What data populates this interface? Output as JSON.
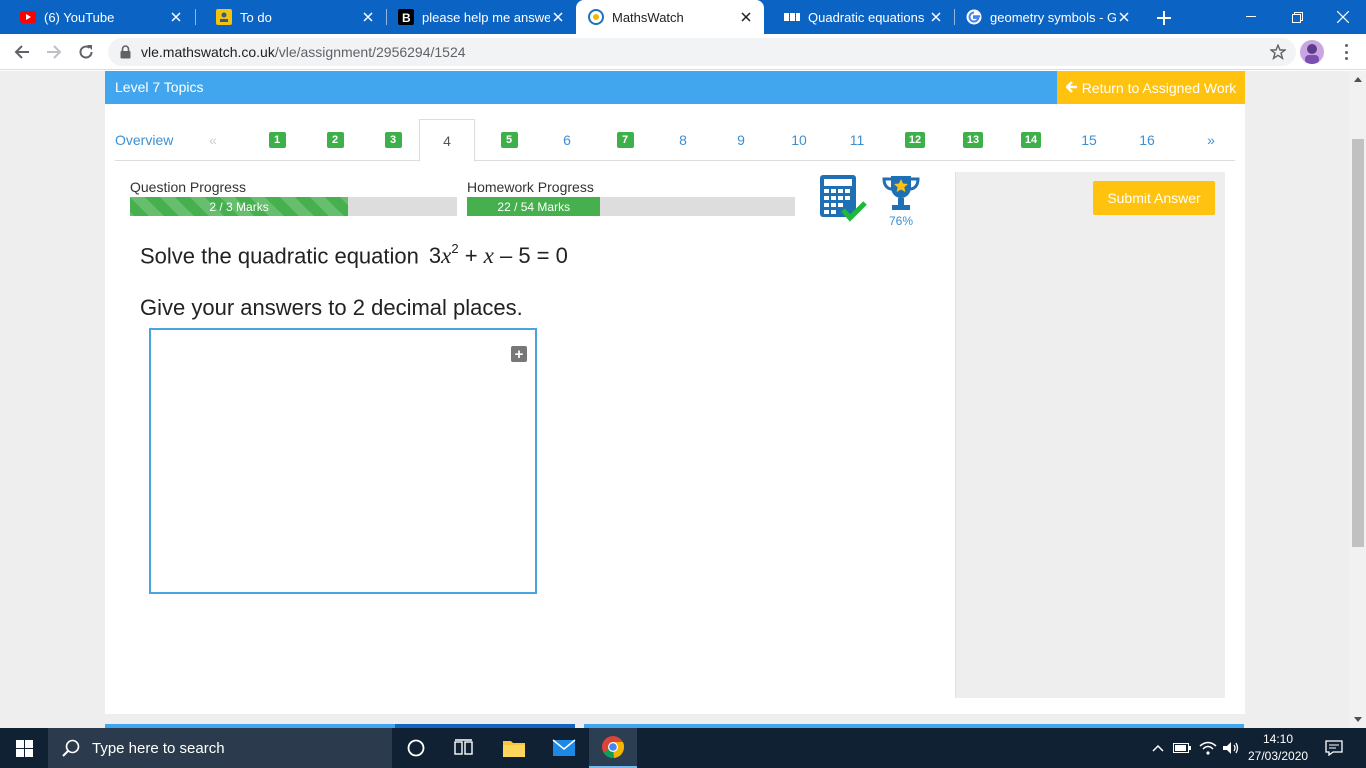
{
  "browser": {
    "tabs": [
      {
        "title": "(6) YouTube",
        "icon": "youtube-icon"
      },
      {
        "title": "To do",
        "icon": "todo-icon"
      },
      {
        "title": "please help me answer",
        "icon": "brainly-icon"
      },
      {
        "title": "MathsWatch",
        "icon": "mathswatch-icon",
        "active": true
      },
      {
        "title": "Quadratic equations - S",
        "icon": "bbc-icon"
      },
      {
        "title": "geometry symbols - Go",
        "icon": "google-icon"
      }
    ],
    "url_host": "vle.mathswatch.co.uk",
    "url_path": "/vle/assignment/2956294/1524"
  },
  "header": {
    "level_title": "Level 7 Topics",
    "return_label": "Return to Assigned Work"
  },
  "question_nav": {
    "overview": "Overview",
    "prev": "«",
    "next": "»",
    "items": [
      {
        "label": "1",
        "completed": true
      },
      {
        "label": "2",
        "completed": true
      },
      {
        "label": "3",
        "completed": true
      },
      {
        "label": "4",
        "current": true
      },
      {
        "label": "5",
        "completed": true
      },
      {
        "label": "6"
      },
      {
        "label": "7",
        "completed": true
      },
      {
        "label": "8"
      },
      {
        "label": "9"
      },
      {
        "label": "10"
      },
      {
        "label": "11"
      },
      {
        "label": "12",
        "completed": true
      },
      {
        "label": "13",
        "completed": true
      },
      {
        "label": "14",
        "completed": true
      },
      {
        "label": "15"
      },
      {
        "label": "16"
      }
    ]
  },
  "progress": {
    "question_label": "Question Progress",
    "question_text": "2 / 3 Marks",
    "question_fraction": 0.667,
    "homework_label": "Homework Progress",
    "homework_text": "22 / 54 Marks",
    "homework_fraction": 0.407
  },
  "trophy_percent": "76%",
  "question": {
    "text": "Solve the quadratic equation",
    "coef": "3",
    "var": "x",
    "exp": "2",
    "mid": " + ",
    "var2": "x",
    "tail": " – 5 = 0",
    "instruction": "Give your answers to 2 decimal places."
  },
  "submit_label": "Submit Answer",
  "taskbar": {
    "search_placeholder": "Type here to search",
    "time": "14:10",
    "date": "27/03/2020"
  },
  "colors": {
    "accent_blue": "#42a6ee",
    "button_yellow": "#ffc20e",
    "complete_green": "#3eb049",
    "chrome_blue": "#0b63c4"
  }
}
